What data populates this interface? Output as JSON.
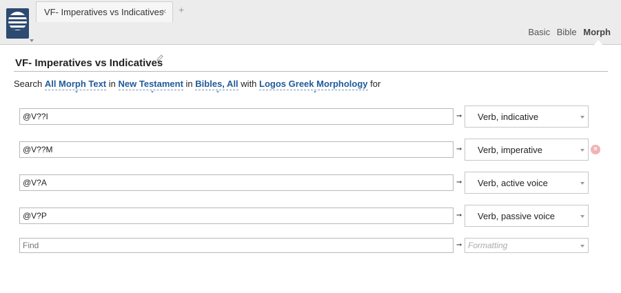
{
  "tab": {
    "title": "VF- Imperatives vs Indicatives",
    "close": "×",
    "add": "+"
  },
  "modes": {
    "basic": "Basic",
    "bible": "Bible",
    "morph": "Morph"
  },
  "page": {
    "title": "VF- Imperatives vs Indicatives"
  },
  "search": {
    "prefix": "Search",
    "text_scope": "All Morph Text",
    "in1": "in",
    "range": "New Testament",
    "in2": "in",
    "collection": "Bibles, All",
    "with": "with",
    "morphology": "Logos Greek Morphology",
    "for": "for"
  },
  "rows": [
    {
      "find": "@V??I",
      "format": "Verb, indicative"
    },
    {
      "find": "@V??M",
      "format": "Verb, imperative"
    },
    {
      "find": "@V?A",
      "format": "Verb, active voice"
    },
    {
      "find": "@V?P",
      "format": "Verb, passive voice"
    }
  ],
  "new_row": {
    "find_placeholder": "Find",
    "format_placeholder": "Formatting"
  },
  "arrow": "➞",
  "remove": "×"
}
